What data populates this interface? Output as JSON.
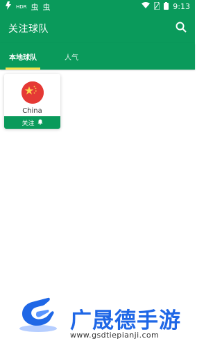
{
  "status": {
    "time": "9:13",
    "hd_label": "HDR",
    "left_glyphs": [
      "虫",
      "虫"
    ]
  },
  "app_bar": {
    "title": "关注球队",
    "search_icon": "search-icon"
  },
  "tabs": [
    {
      "label": "本地球队",
      "active": true
    },
    {
      "label": "人气",
      "active": false
    }
  ],
  "team_cards": [
    {
      "name": "China",
      "follow_label": "关注",
      "flag": "china-flag"
    }
  ],
  "watermark": {
    "title": "广晟德手游",
    "url": "www.gsdtiepianji.com"
  },
  "colors": {
    "primary": "#0a9a5b",
    "tab_indicator": "#f3e24a",
    "brand_blue": "#1f67e6",
    "flag_red": "#e53935",
    "flag_star": "#ffd54f"
  }
}
